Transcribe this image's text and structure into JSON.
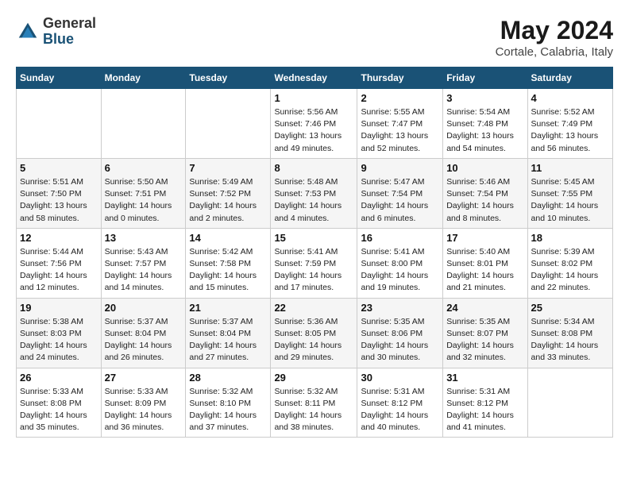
{
  "logo": {
    "general": "General",
    "blue": "Blue"
  },
  "title": {
    "month": "May 2024",
    "location": "Cortale, Calabria, Italy"
  },
  "weekdays": [
    "Sunday",
    "Monday",
    "Tuesday",
    "Wednesday",
    "Thursday",
    "Friday",
    "Saturday"
  ],
  "weeks": [
    [
      {
        "day": "",
        "info": ""
      },
      {
        "day": "",
        "info": ""
      },
      {
        "day": "",
        "info": ""
      },
      {
        "day": "1",
        "info": "Sunrise: 5:56 AM\nSunset: 7:46 PM\nDaylight: 13 hours\nand 49 minutes."
      },
      {
        "day": "2",
        "info": "Sunrise: 5:55 AM\nSunset: 7:47 PM\nDaylight: 13 hours\nand 52 minutes."
      },
      {
        "day": "3",
        "info": "Sunrise: 5:54 AM\nSunset: 7:48 PM\nDaylight: 13 hours\nand 54 minutes."
      },
      {
        "day": "4",
        "info": "Sunrise: 5:52 AM\nSunset: 7:49 PM\nDaylight: 13 hours\nand 56 minutes."
      }
    ],
    [
      {
        "day": "5",
        "info": "Sunrise: 5:51 AM\nSunset: 7:50 PM\nDaylight: 13 hours\nand 58 minutes."
      },
      {
        "day": "6",
        "info": "Sunrise: 5:50 AM\nSunset: 7:51 PM\nDaylight: 14 hours\nand 0 minutes."
      },
      {
        "day": "7",
        "info": "Sunrise: 5:49 AM\nSunset: 7:52 PM\nDaylight: 14 hours\nand 2 minutes."
      },
      {
        "day": "8",
        "info": "Sunrise: 5:48 AM\nSunset: 7:53 PM\nDaylight: 14 hours\nand 4 minutes."
      },
      {
        "day": "9",
        "info": "Sunrise: 5:47 AM\nSunset: 7:54 PM\nDaylight: 14 hours\nand 6 minutes."
      },
      {
        "day": "10",
        "info": "Sunrise: 5:46 AM\nSunset: 7:54 PM\nDaylight: 14 hours\nand 8 minutes."
      },
      {
        "day": "11",
        "info": "Sunrise: 5:45 AM\nSunset: 7:55 PM\nDaylight: 14 hours\nand 10 minutes."
      }
    ],
    [
      {
        "day": "12",
        "info": "Sunrise: 5:44 AM\nSunset: 7:56 PM\nDaylight: 14 hours\nand 12 minutes."
      },
      {
        "day": "13",
        "info": "Sunrise: 5:43 AM\nSunset: 7:57 PM\nDaylight: 14 hours\nand 14 minutes."
      },
      {
        "day": "14",
        "info": "Sunrise: 5:42 AM\nSunset: 7:58 PM\nDaylight: 14 hours\nand 15 minutes."
      },
      {
        "day": "15",
        "info": "Sunrise: 5:41 AM\nSunset: 7:59 PM\nDaylight: 14 hours\nand 17 minutes."
      },
      {
        "day": "16",
        "info": "Sunrise: 5:41 AM\nSunset: 8:00 PM\nDaylight: 14 hours\nand 19 minutes."
      },
      {
        "day": "17",
        "info": "Sunrise: 5:40 AM\nSunset: 8:01 PM\nDaylight: 14 hours\nand 21 minutes."
      },
      {
        "day": "18",
        "info": "Sunrise: 5:39 AM\nSunset: 8:02 PM\nDaylight: 14 hours\nand 22 minutes."
      }
    ],
    [
      {
        "day": "19",
        "info": "Sunrise: 5:38 AM\nSunset: 8:03 PM\nDaylight: 14 hours\nand 24 minutes."
      },
      {
        "day": "20",
        "info": "Sunrise: 5:37 AM\nSunset: 8:04 PM\nDaylight: 14 hours\nand 26 minutes."
      },
      {
        "day": "21",
        "info": "Sunrise: 5:37 AM\nSunset: 8:04 PM\nDaylight: 14 hours\nand 27 minutes."
      },
      {
        "day": "22",
        "info": "Sunrise: 5:36 AM\nSunset: 8:05 PM\nDaylight: 14 hours\nand 29 minutes."
      },
      {
        "day": "23",
        "info": "Sunrise: 5:35 AM\nSunset: 8:06 PM\nDaylight: 14 hours\nand 30 minutes."
      },
      {
        "day": "24",
        "info": "Sunrise: 5:35 AM\nSunset: 8:07 PM\nDaylight: 14 hours\nand 32 minutes."
      },
      {
        "day": "25",
        "info": "Sunrise: 5:34 AM\nSunset: 8:08 PM\nDaylight: 14 hours\nand 33 minutes."
      }
    ],
    [
      {
        "day": "26",
        "info": "Sunrise: 5:33 AM\nSunset: 8:08 PM\nDaylight: 14 hours\nand 35 minutes."
      },
      {
        "day": "27",
        "info": "Sunrise: 5:33 AM\nSunset: 8:09 PM\nDaylight: 14 hours\nand 36 minutes."
      },
      {
        "day": "28",
        "info": "Sunrise: 5:32 AM\nSunset: 8:10 PM\nDaylight: 14 hours\nand 37 minutes."
      },
      {
        "day": "29",
        "info": "Sunrise: 5:32 AM\nSunset: 8:11 PM\nDaylight: 14 hours\nand 38 minutes."
      },
      {
        "day": "30",
        "info": "Sunrise: 5:31 AM\nSunset: 8:12 PM\nDaylight: 14 hours\nand 40 minutes."
      },
      {
        "day": "31",
        "info": "Sunrise: 5:31 AM\nSunset: 8:12 PM\nDaylight: 14 hours\nand 41 minutes."
      },
      {
        "day": "",
        "info": ""
      }
    ]
  ]
}
